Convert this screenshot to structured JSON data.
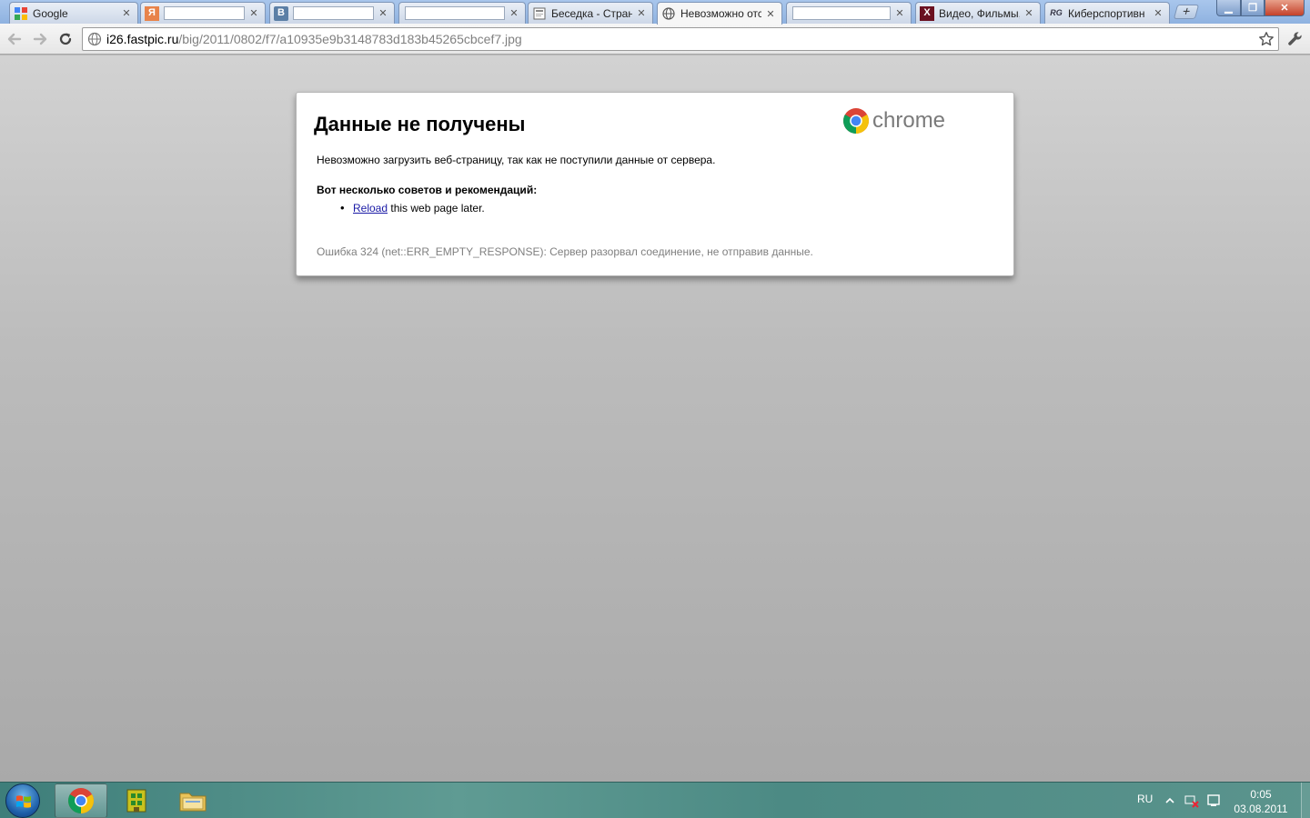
{
  "browser": {
    "tabs": [
      {
        "id": "google",
        "title": "Google",
        "icon": "google-favicon",
        "redacted": false,
        "active": false
      },
      {
        "id": "yandex",
        "title": "",
        "icon": "yandex-favicon",
        "redacted": true,
        "active": false
      },
      {
        "id": "vk",
        "title": "",
        "icon": "vk-favicon",
        "redacted": true,
        "active": false
      },
      {
        "id": "blank",
        "title": "",
        "icon": "page-favicon",
        "redacted": true,
        "active": false
      },
      {
        "id": "beseda",
        "title": "Беседка - Страни",
        "icon": "page-favicon",
        "redacted": false,
        "active": false
      },
      {
        "id": "error",
        "title": "Невозможно отс",
        "icon": "globe-favicon",
        "redacted": false,
        "active": true
      },
      {
        "id": "redacted2",
        "title": "",
        "icon": "page-favicon",
        "redacted": true,
        "active": false
      },
      {
        "id": "video",
        "title": "Видео, Фильмы,",
        "icon": "x-favicon",
        "redacted": false,
        "active": false
      },
      {
        "id": "cyber",
        "title": "Киберспортивн",
        "icon": "cyber-favicon",
        "redacted": false,
        "active": false
      }
    ],
    "favicon_letters": {
      "yandex": "Я",
      "vk": "B",
      "video": "X",
      "cyber": "RG"
    },
    "newtab_label": "+",
    "url": {
      "host": "i26.fastpic.ru",
      "path": "/big/2011/0802/f7/a10935e9b3148783d183b45265cbcef7.jpg"
    }
  },
  "error_page": {
    "heading": "Данные не получены",
    "logo_text": "chrome",
    "description": "Невозможно загрузить веб-страницу, так как не поступили данные от сервера.",
    "tips_heading": "Вот несколько советов и рекомендаций:",
    "tip_link": "Reload",
    "tip_rest": " this web page later.",
    "error_code": "Ошибка 324 (net::ERR_EMPTY_RESPONSE): Сервер разорвал соединение, не отправив данные."
  },
  "taskbar": {
    "language": "RU",
    "time": "0:05",
    "date": "03.08.2011"
  },
  "colors": {
    "link": "#1a1aa6",
    "error_code_text": "#7f7f7f",
    "content_bg": "#bcbcbc"
  }
}
